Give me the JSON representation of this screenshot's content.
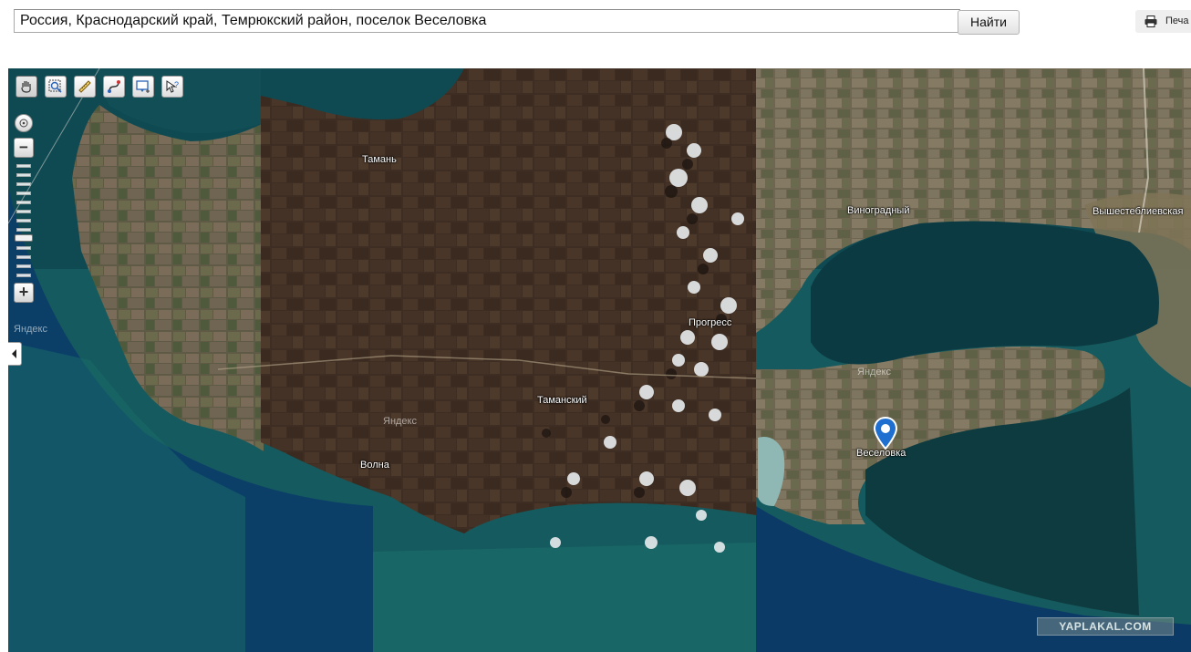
{
  "search": {
    "value": "Россия, Краснодарский край, Темрюкский район, поселок Веселовка",
    "button_label": "Найти"
  },
  "print": {
    "label": "Печа",
    "icon": "printer-icon"
  },
  "map": {
    "toolbar": [
      {
        "name": "hand-tool",
        "icon": "hand-icon",
        "active": true
      },
      {
        "name": "magnifier-tool",
        "icon": "magnifier-icon"
      },
      {
        "name": "ruler-tool",
        "icon": "ruler-icon"
      },
      {
        "name": "route-tool",
        "icon": "route-icon"
      },
      {
        "name": "add-object-tool",
        "icon": "add-object-icon"
      },
      {
        "name": "info-tool",
        "icon": "cursor-question-icon"
      }
    ],
    "zoom": {
      "minus": "−",
      "plus": "+"
    },
    "labels": {
      "taman": "Тамань",
      "vinogradny": "Виноградный",
      "vyshestebliyevskaya": "Вышестеблиевская",
      "progress": "Прогресс",
      "tamansky": "Таманский",
      "volna": "Волна",
      "veselovka": "Веселовка"
    },
    "watermarks": [
      "Яндекс",
      "Яндекс",
      "Яндекс"
    ],
    "site_watermark": "YAPLAKAL.COM"
  }
}
